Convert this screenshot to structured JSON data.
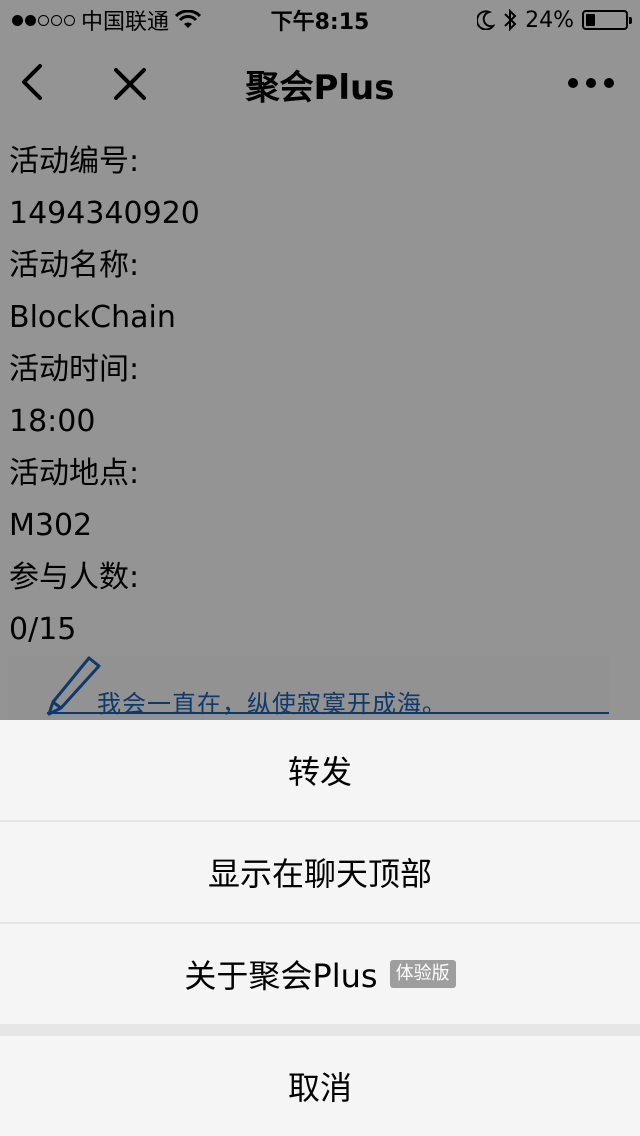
{
  "status_bar": {
    "carrier": "中国联通",
    "time": "下午8:15",
    "battery": "24%",
    "battery_level": 0.24,
    "signal_strength": 2
  },
  "navbar": {
    "title": "聚会Plus"
  },
  "event": {
    "fields": [
      {
        "label": "活动编号:",
        "value": "1494340920"
      },
      {
        "label": "活动名称:",
        "value": "BlockChain"
      },
      {
        "label": "活动时间:",
        "value": "18:00"
      },
      {
        "label": "活动地点:",
        "value": "M302"
      },
      {
        "label": "参与人数:",
        "value": "0/15"
      }
    ]
  },
  "banner": {
    "text": "我会一直在，纵使寂寞开成海。"
  },
  "action_sheet": {
    "items": [
      {
        "label": "转发"
      },
      {
        "label": "显示在聊天顶部"
      },
      {
        "label": "关于聚会Plus",
        "badge": "体验版"
      }
    ],
    "cancel_label": "取消"
  }
}
